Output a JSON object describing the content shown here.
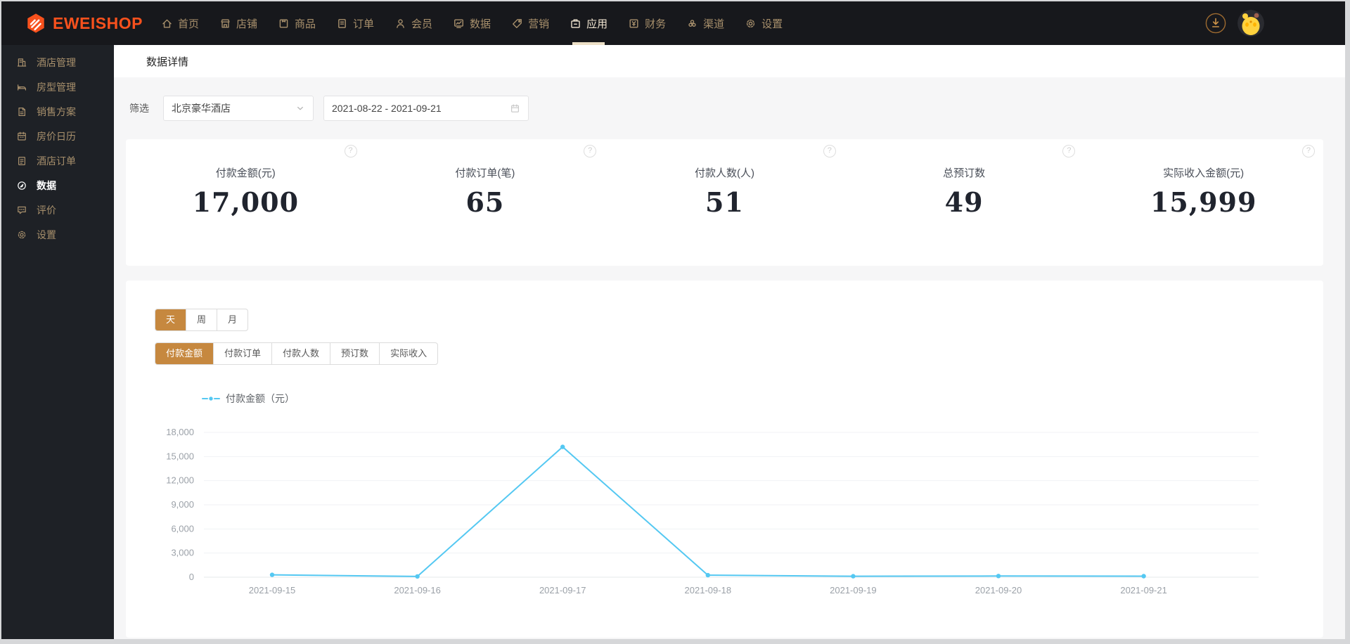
{
  "topnav": {
    "logo_text": "EWEISHOP",
    "items": [
      {
        "label": "首页",
        "icon": "home-icon",
        "active": false
      },
      {
        "label": "店铺",
        "icon": "shop-icon",
        "active": false
      },
      {
        "label": "商品",
        "icon": "goods-icon",
        "active": false
      },
      {
        "label": "订单",
        "icon": "order-icon",
        "active": false
      },
      {
        "label": "会员",
        "icon": "member-icon",
        "active": false
      },
      {
        "label": "数据",
        "icon": "data-board-icon",
        "active": false
      },
      {
        "label": "营销",
        "icon": "marketing-tag-icon",
        "active": false
      },
      {
        "label": "应用",
        "icon": "apps-icon",
        "active": true
      },
      {
        "label": "财务",
        "icon": "finance-icon",
        "active": false
      },
      {
        "label": "渠道",
        "icon": "channel-icon",
        "active": false
      },
      {
        "label": "设置",
        "icon": "settings-gear-icon",
        "active": false
      }
    ],
    "right_icons": [
      "download-icon",
      "avatar"
    ]
  },
  "sidebar": {
    "items": [
      {
        "label": "酒店管理",
        "icon": "hotel-building-icon",
        "active": false
      },
      {
        "label": "房型管理",
        "icon": "bed-icon",
        "active": false
      },
      {
        "label": "销售方案",
        "icon": "sales-doc-icon",
        "active": false
      },
      {
        "label": "房价日历",
        "icon": "calendar-icon",
        "active": false
      },
      {
        "label": "酒店订单",
        "icon": "order-list-icon",
        "active": false
      },
      {
        "label": "数据",
        "icon": "data-compass-icon",
        "active": true
      },
      {
        "label": "评价",
        "icon": "comment-icon",
        "active": false
      },
      {
        "label": "设置",
        "icon": "settings-gear-icon",
        "active": false
      }
    ]
  },
  "page": {
    "title": "数据详情"
  },
  "filter": {
    "label": "筛选",
    "hotel_select": {
      "value": "北京豪华酒店"
    },
    "date_range": {
      "value": "2021-08-22 - 2021-09-21"
    }
  },
  "stats": {
    "cards": [
      {
        "label": "付款金额(元)",
        "value": "17,000",
        "help": "?"
      },
      {
        "label": "付款订单(笔)",
        "value": "65",
        "help": "?"
      },
      {
        "label": "付款人数(人)",
        "value": "51",
        "help": "?"
      },
      {
        "label": "总预订数",
        "value": "49",
        "help": "?"
      },
      {
        "label": "实际收入金额(元)",
        "value": "15,999",
        "help": "?"
      }
    ]
  },
  "chart_panel": {
    "period_tabs": [
      {
        "label": "天",
        "active": true
      },
      {
        "label": "周",
        "active": false
      },
      {
        "label": "月",
        "active": false
      }
    ],
    "metric_tabs": [
      {
        "label": "付款金额",
        "active": true
      },
      {
        "label": "付款订单",
        "active": false
      },
      {
        "label": "付款人数",
        "active": false
      },
      {
        "label": "预订数",
        "active": false
      },
      {
        "label": "实际收入",
        "active": false
      }
    ],
    "legend": "付款金额（元）"
  },
  "chart_data": {
    "type": "line",
    "title": "付款金额（元）",
    "x": [
      "2021-09-15",
      "2021-09-16",
      "2021-09-17",
      "2021-09-18",
      "2021-09-19",
      "2021-09-20",
      "2021-09-21"
    ],
    "series": [
      {
        "name": "付款金额（元）",
        "values": [
          300,
          100,
          16200,
          250,
          120,
          150,
          130
        ]
      }
    ],
    "ylim": [
      0,
      18000
    ],
    "ytick_step": 3000,
    "grid": true,
    "legend_position": "top-left",
    "line_color": "#54c8f2"
  },
  "colors": {
    "accent_orange": "#c6883f",
    "logo_orange": "#f8511d",
    "line_blue": "#54c8f2",
    "navbar_bg": "#17181c",
    "sidebar_bg": "#1e2126",
    "nav_text": "#a8906c",
    "nav_active_text": "#f0e4d0"
  }
}
